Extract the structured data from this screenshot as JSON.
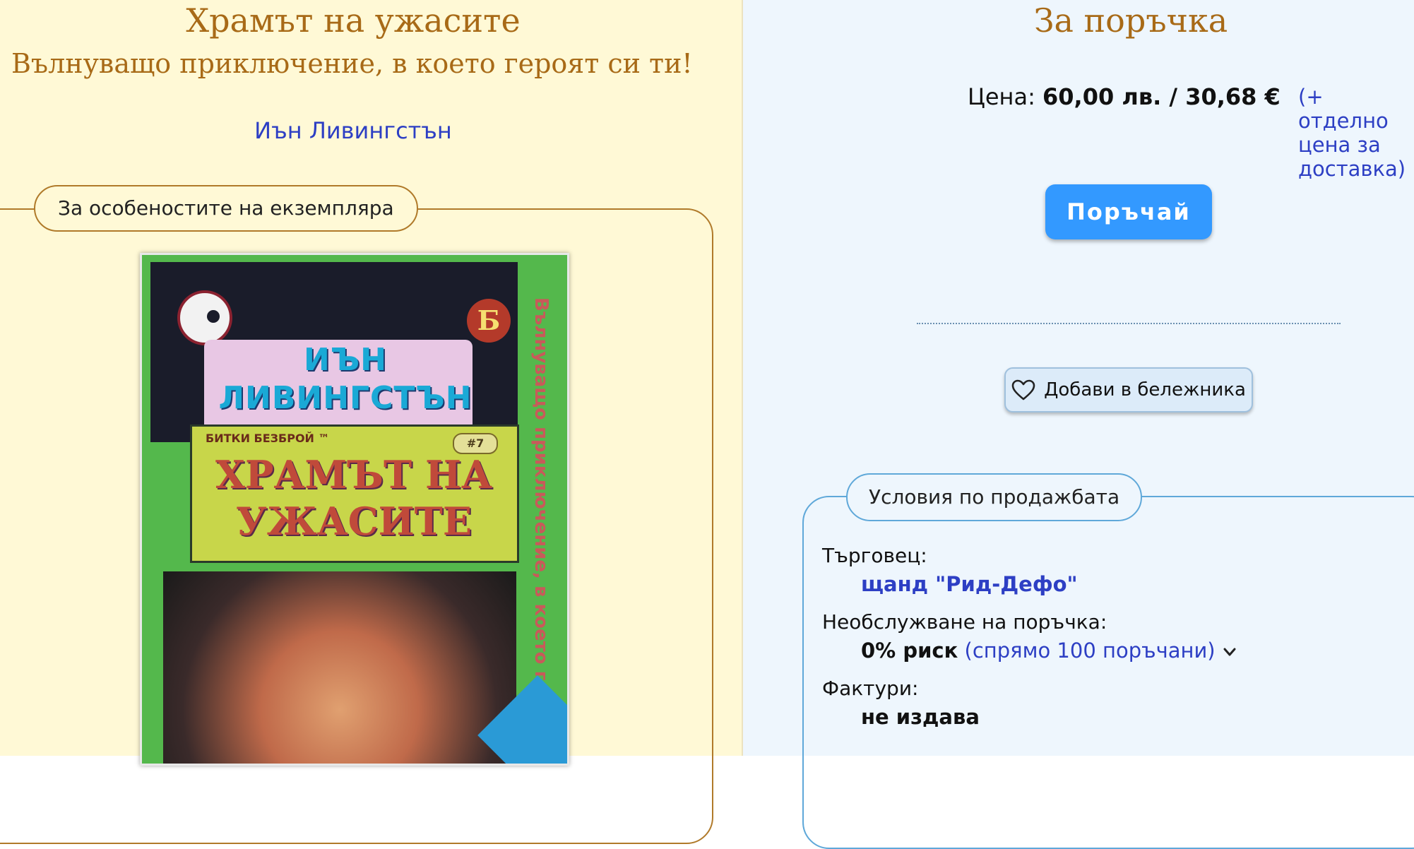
{
  "book": {
    "title": "Храмът на ужасите",
    "subtitle": "Вълнуващо приключение, в което героят си ти!",
    "author": "Иън Ливингстън"
  },
  "copy_section": {
    "legend": "За особеностите на екземпляра"
  },
  "cover_image": {
    "author_text": "ИЪН ЛИВИНГСТЪН",
    "series_text": "БИТКИ БЕЗБРОЙ ™",
    "number": "#7",
    "title_text": "ХРАМЪТ НА УЖАСИТЕ",
    "badge": "Б",
    "spine_text": "Вълнуващо приключение, в което геро"
  },
  "order": {
    "title": "За поръчка",
    "price_label": "Цена:",
    "price_value": "60,00 лв. / 30,68 €",
    "delivery_note": "(+ отделно цена за доставка)",
    "order_button": "Поръчай",
    "favorite_button": "Добави в бележника"
  },
  "sale_terms": {
    "legend": "Условия по продажбата",
    "merchant_label": "Търговец:",
    "merchant_value": "щанд \"Рид-Дефо\"",
    "risk_label": "Необслужване на поръчка:",
    "risk_value": "0% риск",
    "risk_note": "(спрямо 100 поръчани)",
    "invoice_label": "Фактури:",
    "invoice_value": "не издава"
  },
  "icons": {
    "favorite": "heart-icon",
    "expand": "chevron-down-icon"
  },
  "colors": {
    "heading": "#a86a17",
    "link": "#2d3fc4",
    "button": "#3399ff",
    "left_bg": "#fff9d6",
    "right_bg": "#eef6fd"
  }
}
